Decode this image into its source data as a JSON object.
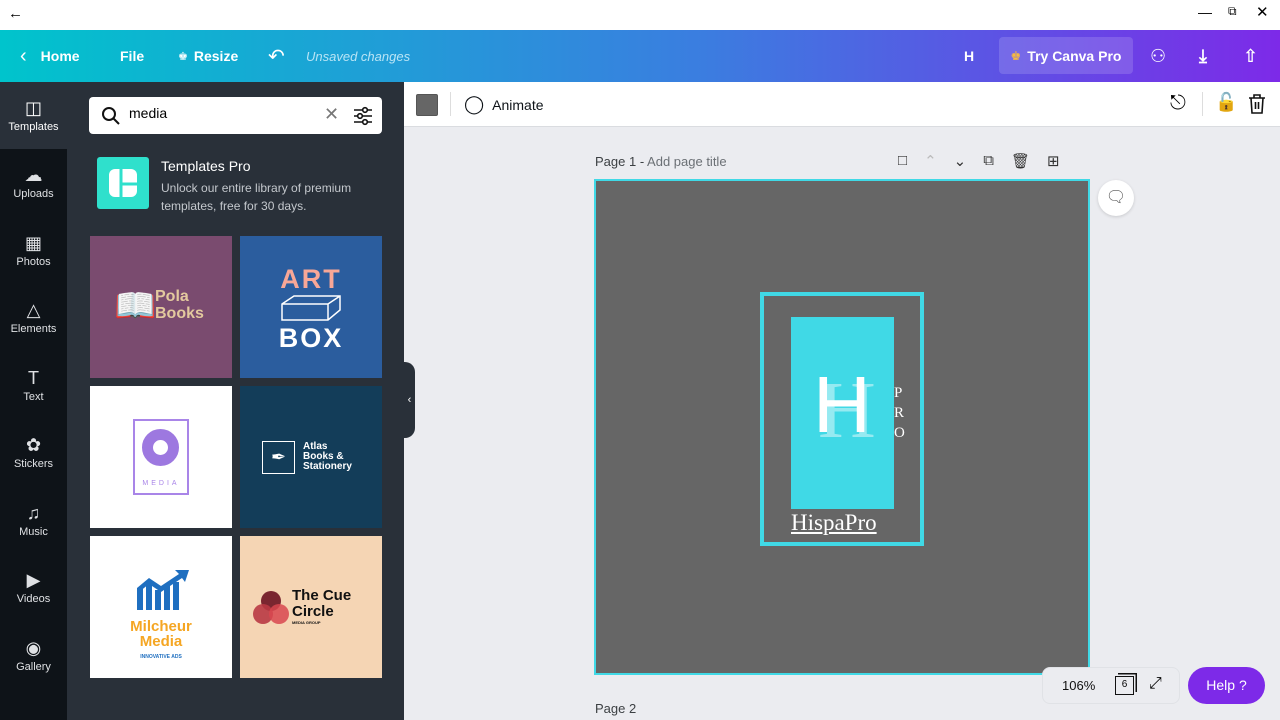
{
  "header": {
    "home": "Home",
    "file": "File",
    "resize": "Resize",
    "status": "Unsaved changes",
    "avatar": "H",
    "try_pro": "Try Canva Pro"
  },
  "sidebar": {
    "items": [
      {
        "label": "Templates",
        "icon": "templates-icon"
      },
      {
        "label": "Uploads",
        "icon": "upload-cloud-icon"
      },
      {
        "label": "Photos",
        "icon": "image-icon"
      },
      {
        "label": "Elements",
        "icon": "shapes-icon"
      },
      {
        "label": "Text",
        "icon": "text-icon"
      },
      {
        "label": "Stickers",
        "icon": "sticker-icon"
      },
      {
        "label": "Music",
        "icon": "music-icon"
      },
      {
        "label": "Videos",
        "icon": "video-icon"
      },
      {
        "label": "Gallery",
        "icon": "camera-icon"
      }
    ]
  },
  "panel": {
    "search_value": "media",
    "promo_title": "Templates Pro",
    "promo_desc_1": "Unlock our entire library of premium",
    "promo_desc_2": "templates, free for 30 days.",
    "templates": [
      {
        "line1": "Pola",
        "line2": "Books",
        "bg": "#7a4b6f"
      },
      {
        "line1": "ART",
        "line2": "BOX",
        "bg": "#2b5d9e"
      },
      {
        "line1": "MEDIA",
        "bg": "#ffffff"
      },
      {
        "line1": "Atlas",
        "line2": "Books &",
        "line3": "Stationery",
        "bg": "#133d59"
      },
      {
        "line1": "Milcheur",
        "line2": "Media",
        "line3": "INNOVATIVE ADS",
        "bg": "#ffffff"
      },
      {
        "line1": "The Cue",
        "line2": "Circle",
        "line3": "MEDIA GROUP",
        "bg": "#f5d5b4"
      }
    ]
  },
  "toolbar": {
    "animate": "Animate",
    "color": "#666666"
  },
  "canvas": {
    "page1_label": "Page 1 - ",
    "page1_title_placeholder": "Add page title",
    "page2_label": "Page 2",
    "logo_letter": "H",
    "logo_side": [
      "P",
      "R",
      "O"
    ],
    "logo_name": "HispaPro",
    "accent": "#40d9e6",
    "bg": "#666666"
  },
  "footer": {
    "zoom": "106%",
    "pages": "6",
    "help": "Help ?"
  }
}
